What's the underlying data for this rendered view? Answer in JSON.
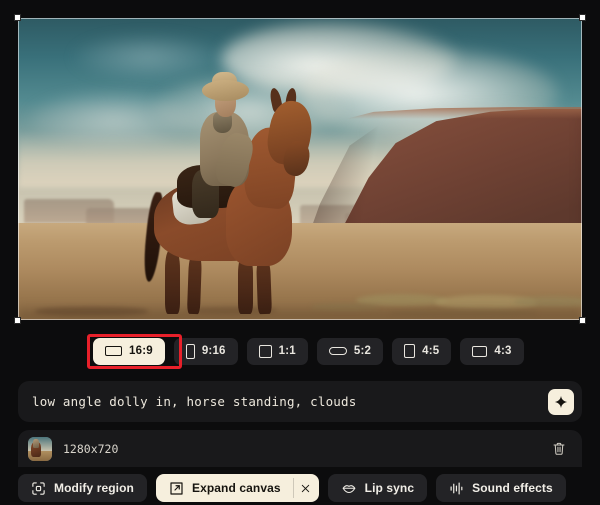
{
  "canvas": {
    "alt": "cowboy riding a brown horse in a desert canyon under cloudy sky",
    "selection_handles": 4
  },
  "aspect_ratios": {
    "options": [
      {
        "label": "16:9",
        "glyph": "rect-landscape-16-9",
        "active": true,
        "highlighted": true
      },
      {
        "label": "9:16",
        "glyph": "rect-portrait-9-16",
        "active": false,
        "highlighted": false
      },
      {
        "label": "1:1",
        "glyph": "square-1-1",
        "active": false,
        "highlighted": false
      },
      {
        "label": "5:2",
        "glyph": "rect-wide-5-2",
        "active": false,
        "highlighted": false
      },
      {
        "label": "4:5",
        "glyph": "rect-portrait-4-5",
        "active": false,
        "highlighted": false
      },
      {
        "label": "4:3",
        "glyph": "rect-landscape-4-3",
        "active": false,
        "highlighted": false
      }
    ],
    "annotation_color": "#e8202a"
  },
  "prompt": {
    "value": "low angle dolly in, horse standing, clouds",
    "placeholder": "Describe your shot",
    "enhance_label": "sparkle-icon"
  },
  "asset": {
    "resolution": "1280x720",
    "delete_label": "trash-icon"
  },
  "tools": [
    {
      "label": "Modify region",
      "icon": "focus-frame-icon",
      "active": false,
      "closable": false
    },
    {
      "label": "Expand canvas",
      "icon": "expand-arrow-icon",
      "active": true,
      "closable": true
    },
    {
      "label": "Lip sync",
      "icon": "lips-icon",
      "active": false,
      "closable": false
    },
    {
      "label": "Sound effects",
      "icon": "waveform-icon",
      "active": false,
      "closable": false
    }
  ],
  "theme": {
    "background": "#0c0c0d",
    "panel": "#19191b",
    "chip": "#232326",
    "accent_cream": "#f6efdd",
    "text": "#ece7dc"
  }
}
